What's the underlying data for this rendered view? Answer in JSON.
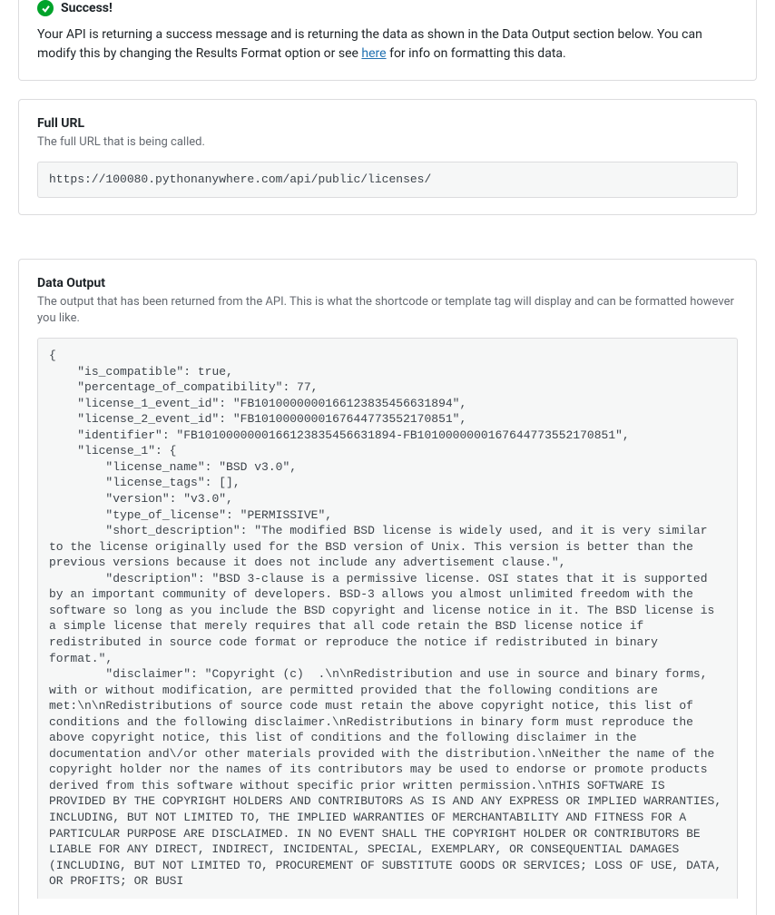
{
  "success": {
    "title": "Success!",
    "desc_before": "Your API is returning a success message and is returning the data as shown in the Data Output section below. You can modify this by changing the Results Format option or see ",
    "link_text": "here",
    "desc_after": " for info on formatting this data."
  },
  "full_url": {
    "title": "Full URL",
    "sub": "The full URL that is being called.",
    "value": "https://100080.pythonanywhere.com/api/public/licenses/"
  },
  "data_output": {
    "title": "Data Output",
    "sub": "The output that has been returned from the API. This is what the shortcode or template tag will display and can be formatted however you like.",
    "value": "{\n    \"is_compatible\": true,\n    \"percentage_of_compatibility\": 77,\n    \"license_1_event_id\": \"FB1010000000166123835456631894\",\n    \"license_2_event_id\": \"FB1010000000167644773552170851\",\n    \"identifier\": \"FB1010000000166123835456631894-FB1010000000167644773552170851\",\n    \"license_1\": {\n        \"license_name\": \"BSD v3.0\",\n        \"license_tags\": [],\n        \"version\": \"v3.0\",\n        \"type_of_license\": \"PERMISSIVE\",\n        \"short_description\": \"The modified BSD license is widely used, and it is very similar to the license originally used for the BSD version of Unix. This version is better than the previous versions because it does not include any advertisement clause.\",\n        \"description\": \"BSD 3-clause is a permissive license. OSI states that it is supported by an important community of developers. BSD-3 allows you almost unlimited freedom with the software so long as you include the BSD copyright and license notice in it. The BSD license is a simple license that merely requires that all code retain the BSD license notice if redistributed in source code format or reproduce the notice if redistributed in binary format.\",\n        \"disclaimer\": \"Copyright (c)  .\\n\\nRedistribution and use in source and binary forms, with or without modification, are permitted provided that the following conditions are met:\\n\\nRedistributions of source code must retain the above copyright notice, this list of conditions and the following disclaimer.\\nRedistributions in binary form must reproduce the above copyright notice, this list of conditions and the following disclaimer in the documentation and\\/or other materials provided with the distribution.\\nNeither the name of the copyright holder nor the names of its contributors may be used to endorse or promote products derived from this software without specific prior written permission.\\nTHIS SOFTWARE IS PROVIDED BY THE COPYRIGHT HOLDERS AND CONTRIBUTORS AS IS AND ANY EXPRESS OR IMPLIED WARRANTIES, INCLUDING, BUT NOT LIMITED TO, THE IMPLIED WARRANTIES OF MERCHANTABILITY AND FITNESS FOR A PARTICULAR PURPOSE ARE DISCLAIMED. IN NO EVENT SHALL THE COPYRIGHT HOLDER OR CONTRIBUTORS BE LIABLE FOR ANY DIRECT, INDIRECT, INCIDENTAL, SPECIAL, EXEMPLARY, OR CONSEQUENTIAL DAMAGES (INCLUDING, BUT NOT LIMITED TO, PROCUREMENT OF SUBSTITUTE GOODS OR SERVICES; LOSS OF USE, DATA, OR PROFITS; OR BUSI"
  }
}
